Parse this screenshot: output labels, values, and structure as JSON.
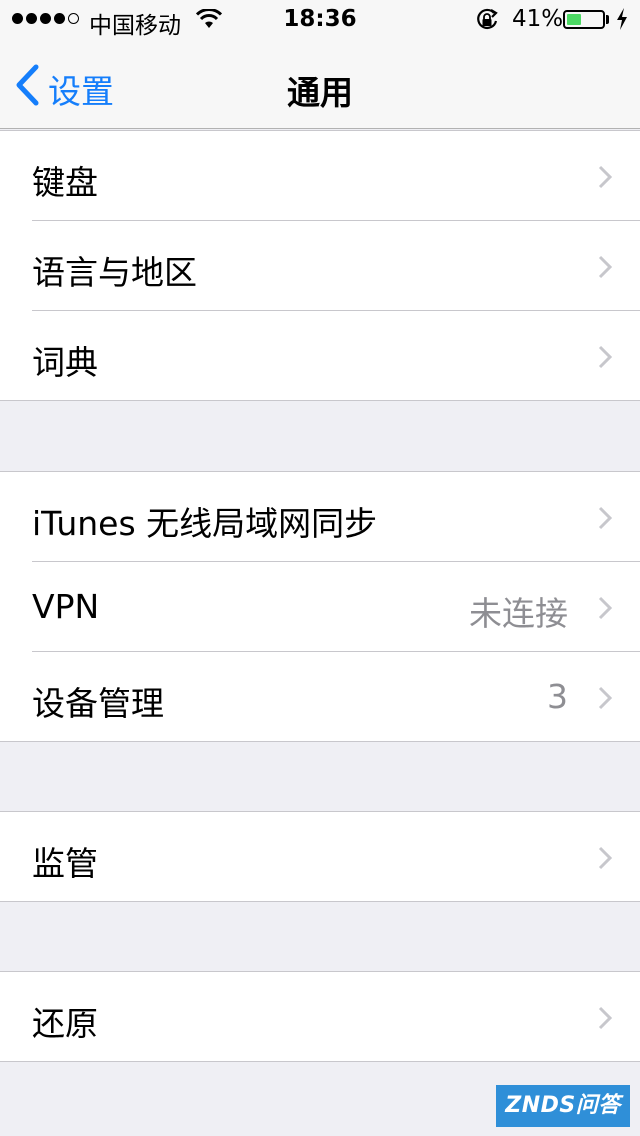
{
  "status_bar": {
    "carrier": "中国移动",
    "time": "18:36",
    "battery_percent_text": "41%",
    "battery_level": 0.41,
    "signal_bars_filled": 4,
    "signal_bars_total": 5,
    "battery_fill_color": "#4cd964"
  },
  "nav": {
    "back_label": "设置",
    "title": "通用",
    "accent_color": "#157efb"
  },
  "groups": [
    {
      "rows": [
        {
          "label": "键盘",
          "detail": ""
        },
        {
          "label": "语言与地区",
          "detail": ""
        },
        {
          "label": "词典",
          "detail": ""
        }
      ]
    },
    {
      "rows": [
        {
          "label": "iTunes 无线局域网同步",
          "detail": ""
        },
        {
          "label": "VPN",
          "detail": "未连接"
        },
        {
          "label": "设备管理",
          "detail": "3"
        }
      ]
    },
    {
      "rows": [
        {
          "label": "监管",
          "detail": ""
        }
      ]
    },
    {
      "rows": [
        {
          "label": "还原",
          "detail": ""
        }
      ]
    }
  ],
  "watermark": "ZNDS问答"
}
